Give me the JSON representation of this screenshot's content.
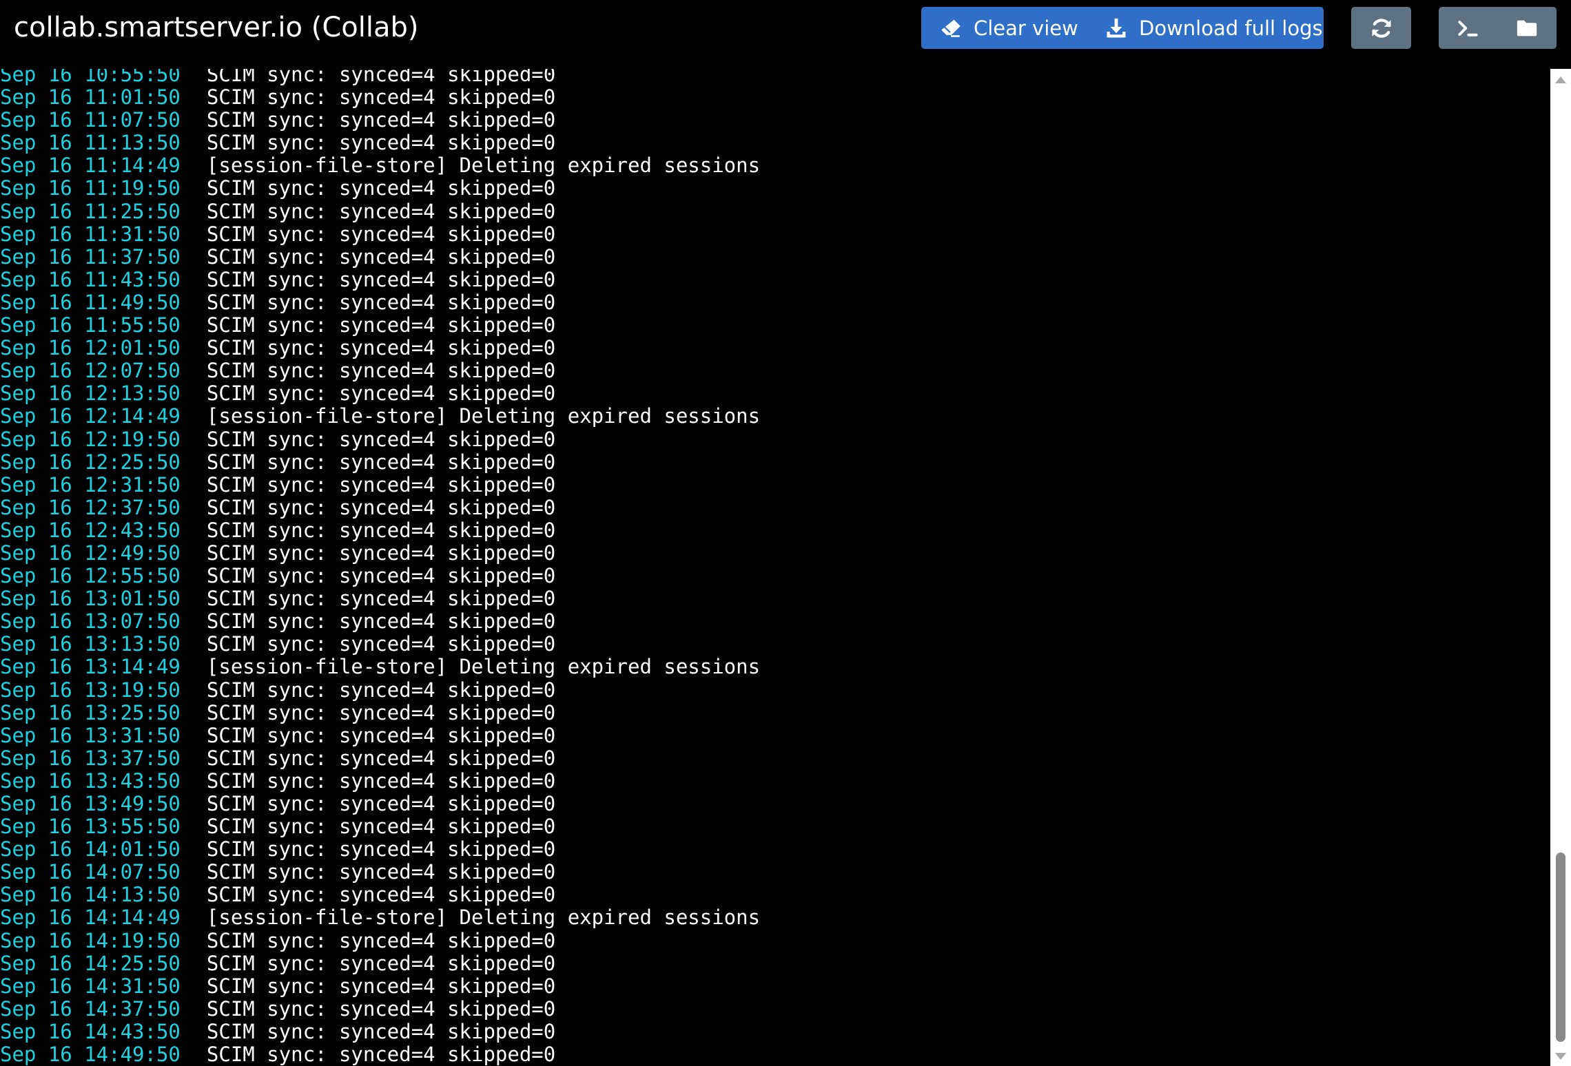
{
  "header": {
    "title": "collab.smartserver.io (Collab)",
    "clear_label": "Clear view",
    "download_label": "Download full logs",
    "icons": {
      "clear": "eraser-icon",
      "download": "download-icon",
      "refresh": "refresh-icon",
      "terminal": "terminal-icon",
      "folder": "folder-icon"
    }
  },
  "colors": {
    "primary_button": "#2f6fc8",
    "secondary_button": "#5f7281",
    "timestamp": "#1fd0e0",
    "text": "#ffffff",
    "background": "#000000"
  },
  "log": {
    "lines": [
      {
        "ts": "Sep 16 10:55:50",
        "msg": "SCIM sync: synced=4 skipped=0"
      },
      {
        "ts": "Sep 16 11:01:50",
        "msg": "SCIM sync: synced=4 skipped=0"
      },
      {
        "ts": "Sep 16 11:07:50",
        "msg": "SCIM sync: synced=4 skipped=0"
      },
      {
        "ts": "Sep 16 11:13:50",
        "msg": "SCIM sync: synced=4 skipped=0"
      },
      {
        "ts": "Sep 16 11:14:49",
        "msg": "[session-file-store] Deleting expired sessions"
      },
      {
        "ts": "Sep 16 11:19:50",
        "msg": "SCIM sync: synced=4 skipped=0"
      },
      {
        "ts": "Sep 16 11:25:50",
        "msg": "SCIM sync: synced=4 skipped=0"
      },
      {
        "ts": "Sep 16 11:31:50",
        "msg": "SCIM sync: synced=4 skipped=0"
      },
      {
        "ts": "Sep 16 11:37:50",
        "msg": "SCIM sync: synced=4 skipped=0"
      },
      {
        "ts": "Sep 16 11:43:50",
        "msg": "SCIM sync: synced=4 skipped=0"
      },
      {
        "ts": "Sep 16 11:49:50",
        "msg": "SCIM sync: synced=4 skipped=0"
      },
      {
        "ts": "Sep 16 11:55:50",
        "msg": "SCIM sync: synced=4 skipped=0"
      },
      {
        "ts": "Sep 16 12:01:50",
        "msg": "SCIM sync: synced=4 skipped=0"
      },
      {
        "ts": "Sep 16 12:07:50",
        "msg": "SCIM sync: synced=4 skipped=0"
      },
      {
        "ts": "Sep 16 12:13:50",
        "msg": "SCIM sync: synced=4 skipped=0"
      },
      {
        "ts": "Sep 16 12:14:49",
        "msg": "[session-file-store] Deleting expired sessions"
      },
      {
        "ts": "Sep 16 12:19:50",
        "msg": "SCIM sync: synced=4 skipped=0"
      },
      {
        "ts": "Sep 16 12:25:50",
        "msg": "SCIM sync: synced=4 skipped=0"
      },
      {
        "ts": "Sep 16 12:31:50",
        "msg": "SCIM sync: synced=4 skipped=0"
      },
      {
        "ts": "Sep 16 12:37:50",
        "msg": "SCIM sync: synced=4 skipped=0"
      },
      {
        "ts": "Sep 16 12:43:50",
        "msg": "SCIM sync: synced=4 skipped=0"
      },
      {
        "ts": "Sep 16 12:49:50",
        "msg": "SCIM sync: synced=4 skipped=0"
      },
      {
        "ts": "Sep 16 12:55:50",
        "msg": "SCIM sync: synced=4 skipped=0"
      },
      {
        "ts": "Sep 16 13:01:50",
        "msg": "SCIM sync: synced=4 skipped=0"
      },
      {
        "ts": "Sep 16 13:07:50",
        "msg": "SCIM sync: synced=4 skipped=0"
      },
      {
        "ts": "Sep 16 13:13:50",
        "msg": "SCIM sync: synced=4 skipped=0"
      },
      {
        "ts": "Sep 16 13:14:49",
        "msg": "[session-file-store] Deleting expired sessions"
      },
      {
        "ts": "Sep 16 13:19:50",
        "msg": "SCIM sync: synced=4 skipped=0"
      },
      {
        "ts": "Sep 16 13:25:50",
        "msg": "SCIM sync: synced=4 skipped=0"
      },
      {
        "ts": "Sep 16 13:31:50",
        "msg": "SCIM sync: synced=4 skipped=0"
      },
      {
        "ts": "Sep 16 13:37:50",
        "msg": "SCIM sync: synced=4 skipped=0"
      },
      {
        "ts": "Sep 16 13:43:50",
        "msg": "SCIM sync: synced=4 skipped=0"
      },
      {
        "ts": "Sep 16 13:49:50",
        "msg": "SCIM sync: synced=4 skipped=0"
      },
      {
        "ts": "Sep 16 13:55:50",
        "msg": "SCIM sync: synced=4 skipped=0"
      },
      {
        "ts": "Sep 16 14:01:50",
        "msg": "SCIM sync: synced=4 skipped=0"
      },
      {
        "ts": "Sep 16 14:07:50",
        "msg": "SCIM sync: synced=4 skipped=0"
      },
      {
        "ts": "Sep 16 14:13:50",
        "msg": "SCIM sync: synced=4 skipped=0"
      },
      {
        "ts": "Sep 16 14:14:49",
        "msg": "[session-file-store] Deleting expired sessions"
      },
      {
        "ts": "Sep 16 14:19:50",
        "msg": "SCIM sync: synced=4 skipped=0"
      },
      {
        "ts": "Sep 16 14:25:50",
        "msg": "SCIM sync: synced=4 skipped=0"
      },
      {
        "ts": "Sep 16 14:31:50",
        "msg": "SCIM sync: synced=4 skipped=0"
      },
      {
        "ts": "Sep 16 14:37:50",
        "msg": "SCIM sync: synced=4 skipped=0"
      },
      {
        "ts": "Sep 16 14:43:50",
        "msg": "SCIM sync: synced=4 skipped=0"
      },
      {
        "ts": "Sep 16 14:49:50",
        "msg": "SCIM sync: synced=4 skipped=0"
      }
    ]
  }
}
